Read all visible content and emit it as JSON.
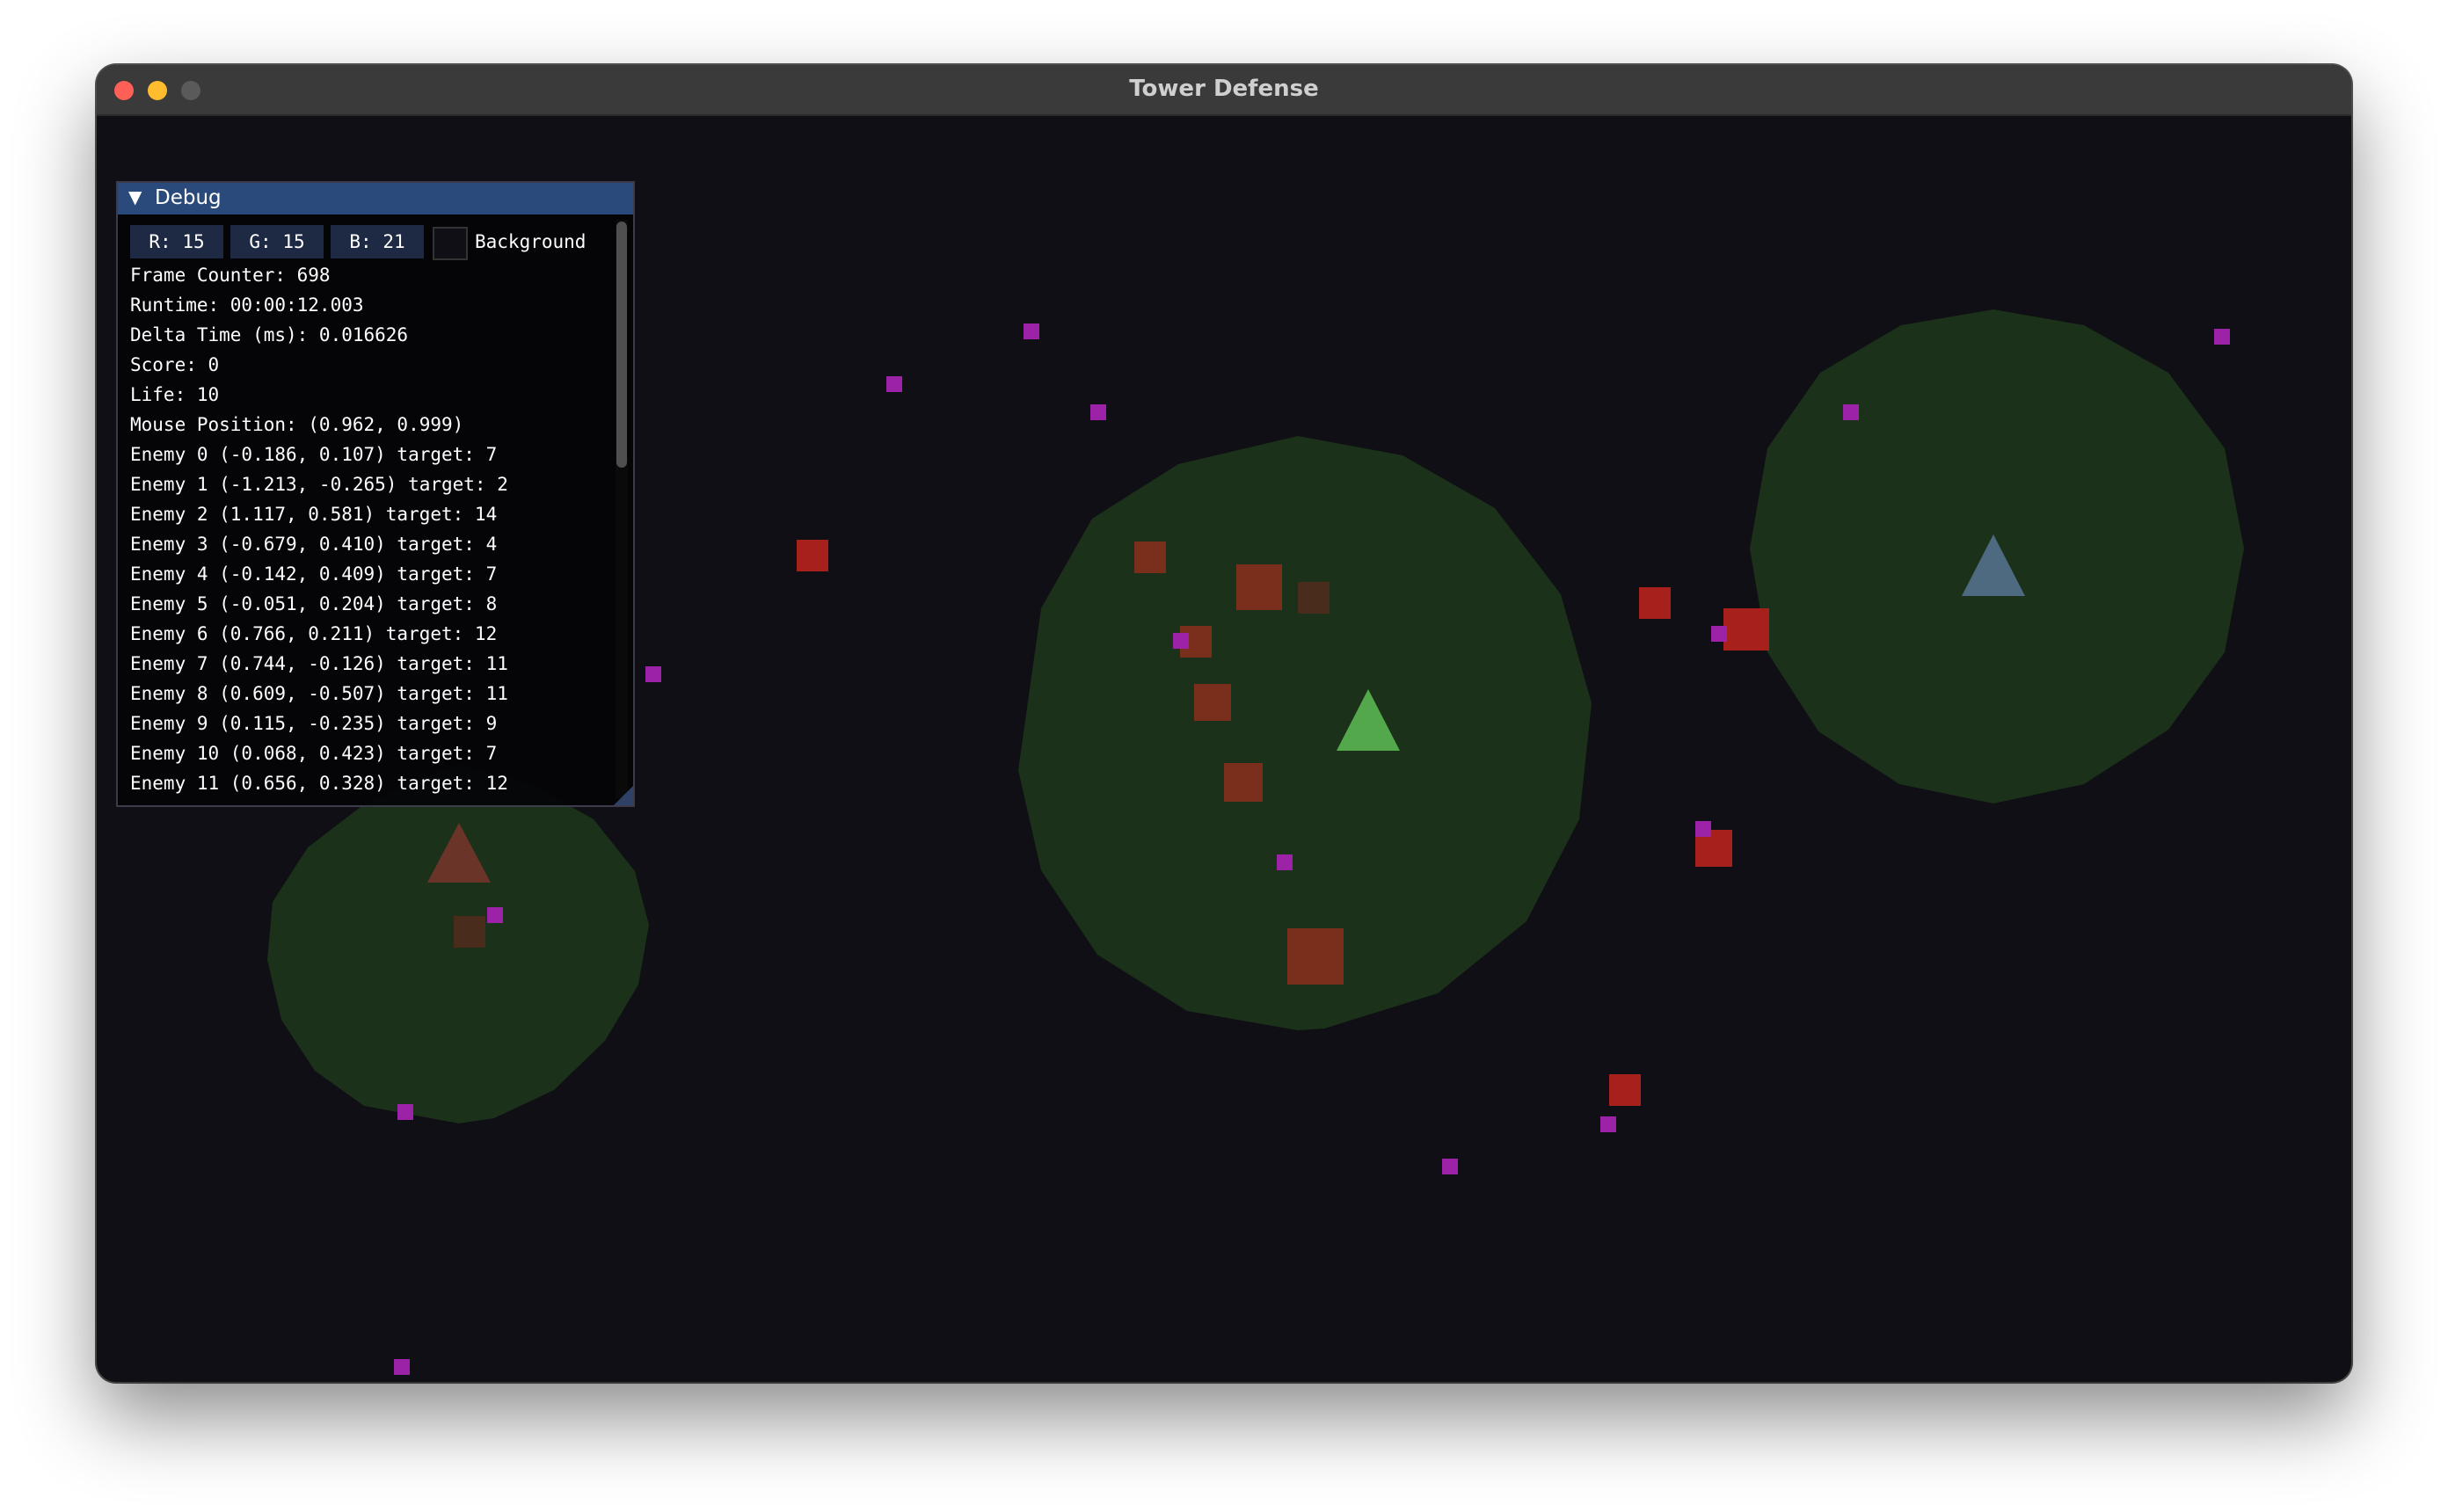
{
  "window": {
    "title": "Tower Defense"
  },
  "colors": {
    "background": "#0f0f15",
    "range": "#1c3119",
    "enemy": "#a8201c",
    "projectile": "#9c22a8",
    "tower_active": "#52a84a",
    "tower_red": "#6b3428",
    "tower_blue": "#4d6a80"
  },
  "debug": {
    "title": "Debug",
    "r": "R: 15",
    "g": "G: 15",
    "b": "B: 21",
    "background_label": "Background",
    "lines": [
      "Frame Counter: 698",
      "Runtime: 00:00:12.003",
      "Delta Time (ms): 0.016626",
      "Score: 0",
      "Life: 10",
      "Mouse Position: (0.962, 0.999)",
      "Enemy 0 (-0.186, 0.107) target: 7",
      "Enemy 1 (-1.213, -0.265) target: 2",
      "Enemy 2 (1.117, 0.581) target: 14",
      "Enemy 3 (-0.679, 0.410) target: 4",
      "Enemy 4 (-0.142, 0.409) target: 7",
      "Enemy 5 (-0.051, 0.204) target: 8",
      "Enemy 6 (0.766, 0.211) target: 12",
      "Enemy 7 (0.744, -0.126) target: 11",
      "Enemy 8 (0.609, -0.507) target: 11",
      "Enemy 9 (0.115, -0.235) target: 9",
      "Enemy 10 (0.068, 0.423) target: 7",
      "Enemy 11 (0.656, 0.328) target: 12"
    ]
  }
}
